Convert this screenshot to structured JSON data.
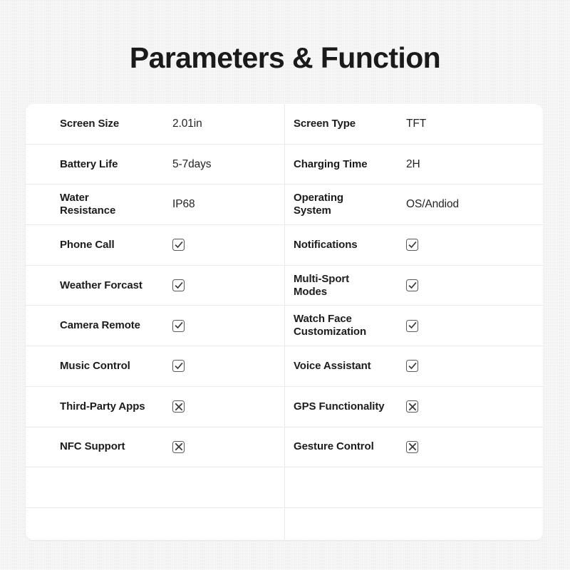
{
  "page": {
    "title": "Parameters & Function",
    "background_color": "#f2f2f2",
    "card_color": "#ffffff",
    "text_color": "#1c1c1c",
    "divider_color": "#eaeaea"
  },
  "icons": {
    "checked": "checkbox-checked-icon",
    "unchecked": "checkbox-x-icon"
  },
  "table": {
    "rows": [
      {
        "left": {
          "label": "Screen Size",
          "value": "2.01in",
          "type": "text"
        },
        "right": {
          "label": "Screen Type",
          "value": "TFT",
          "type": "text"
        }
      },
      {
        "left": {
          "label": "Battery Life",
          "value": "5-7days",
          "type": "text"
        },
        "right": {
          "label": "Charging Time",
          "value": "2H",
          "type": "text"
        }
      },
      {
        "left": {
          "label": "Water\nResistance",
          "value": "IP68",
          "type": "text"
        },
        "right": {
          "label": "Operating\nSystem",
          "value": "OS/Andiod",
          "type": "text"
        }
      },
      {
        "left": {
          "label": "Phone Call",
          "value": "checked",
          "type": "state"
        },
        "right": {
          "label": "Notifications",
          "value": "checked",
          "type": "state"
        }
      },
      {
        "left": {
          "label": "Weather Forcast",
          "value": "checked",
          "type": "state"
        },
        "right": {
          "label": "Multi-Sport\nModes",
          "value": "checked",
          "type": "state"
        }
      },
      {
        "left": {
          "label": "Camera Remote",
          "value": "checked",
          "type": "state"
        },
        "right": {
          "label": "Watch Face\nCustomization",
          "value": "checked",
          "type": "state"
        }
      },
      {
        "left": {
          "label": "Music Control",
          "value": "checked",
          "type": "state"
        },
        "right": {
          "label": "Voice Assistant",
          "value": "checked",
          "type": "state"
        }
      },
      {
        "left": {
          "label": "Third-Party Apps",
          "value": "unchecked",
          "type": "state"
        },
        "right": {
          "label": "GPS Functionality",
          "value": "unchecked",
          "type": "state"
        }
      },
      {
        "left": {
          "label": "NFC Support",
          "value": "unchecked",
          "type": "state"
        },
        "right": {
          "label": "Gesture Control",
          "value": "unchecked",
          "type": "state"
        }
      },
      {
        "left": {
          "label": "",
          "value": "",
          "type": "empty"
        },
        "right": {
          "label": "",
          "value": "",
          "type": "empty"
        }
      },
      {
        "left": {
          "label": "",
          "value": "",
          "type": "empty"
        },
        "right": {
          "label": "",
          "value": "",
          "type": "empty"
        }
      }
    ]
  }
}
